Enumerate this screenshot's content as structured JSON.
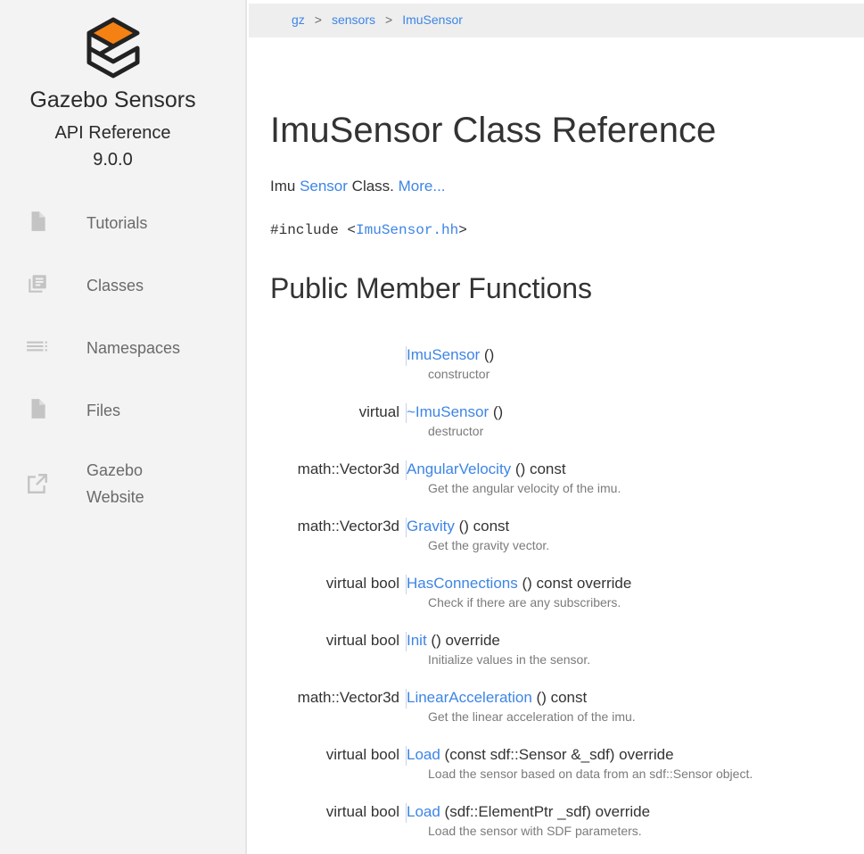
{
  "sidebar": {
    "project_name": "Gazebo Sensors",
    "project_sub": "API Reference",
    "version": "9.0.0",
    "nav": [
      {
        "label": "Tutorials",
        "icon": "file-icon"
      },
      {
        "label": "Classes",
        "icon": "library-icon"
      },
      {
        "label": "Namespaces",
        "icon": "list-icon"
      },
      {
        "label": "Files",
        "icon": "file-icon"
      },
      {
        "label_line1": "Gazebo",
        "label_line2": "Website",
        "icon": "external-link-icon"
      }
    ]
  },
  "breadcrumb": {
    "items": [
      "gz",
      "sensors",
      "ImuSensor"
    ],
    "separator": ">"
  },
  "main": {
    "title": "ImuSensor Class Reference",
    "brief": {
      "prefix": "Imu ",
      "link": "Sensor",
      "suffix": " Class. ",
      "more": "More..."
    },
    "include": {
      "prefix": "#include <",
      "file": "ImuSensor.hh",
      "suffix": ">"
    },
    "section_title": "Public Member Functions",
    "members": [
      {
        "ret": "",
        "name": "ImuSensor",
        "rest": " ()",
        "desc": "constructor"
      },
      {
        "ret": "virtual",
        "name": "~ImuSensor",
        "rest": " ()",
        "desc": "destructor"
      },
      {
        "ret": "math::Vector3d",
        "name": "AngularVelocity",
        "rest": " () const",
        "desc": "Get the angular velocity of the imu."
      },
      {
        "ret": "math::Vector3d",
        "name": "Gravity",
        "rest": " () const",
        "desc": "Get the gravity vector."
      },
      {
        "ret": "virtual bool",
        "name": "HasConnections",
        "rest": " () const override",
        "desc": "Check if there are any subscribers."
      },
      {
        "ret": "virtual bool",
        "name": "Init",
        "rest": " () override",
        "desc": "Initialize values in the sensor."
      },
      {
        "ret": "math::Vector3d",
        "name": "LinearAcceleration",
        "rest": " () const",
        "desc": "Get the linear acceleration of the imu."
      },
      {
        "ret": "virtual bool",
        "name": "Load",
        "rest": " (const sdf::Sensor &_sdf) override",
        "desc": "Load the sensor based on data from an sdf::Sensor object."
      },
      {
        "ret": "virtual bool",
        "name": "Load",
        "rest": " (sdf::ElementPtr _sdf) override",
        "desc": "Load the sensor with SDF parameters."
      }
    ]
  },
  "colors": {
    "link": "#3d85e6",
    "logo_orange": "#f58113",
    "sidebar_bg": "#f3f3f3"
  }
}
